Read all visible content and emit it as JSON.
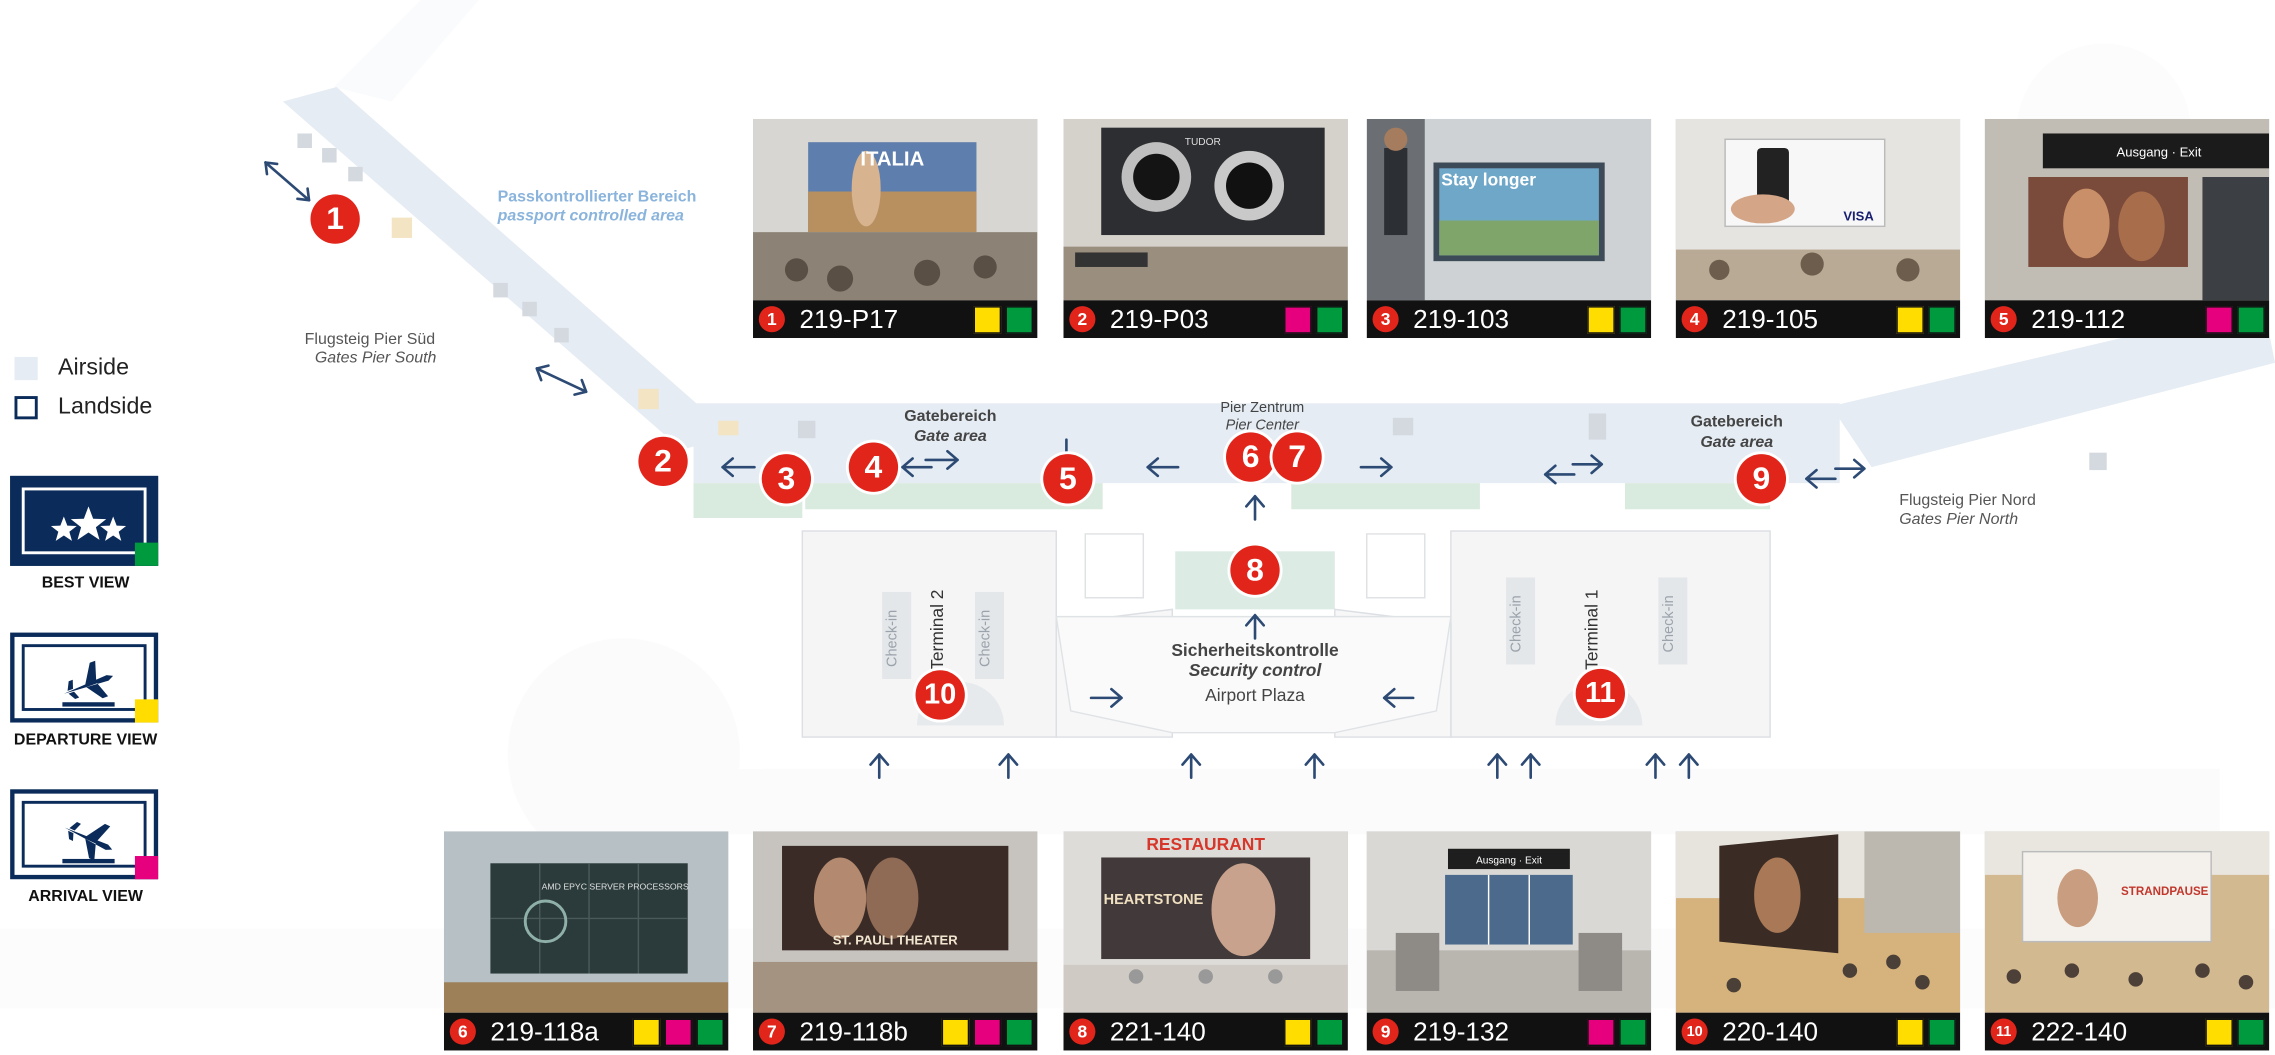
{
  "legend": {
    "airside_label": "Airside",
    "landside_label": "Landside",
    "airside_color": "#e5ecf3",
    "landside_color": "#ffffff"
  },
  "view_types": [
    {
      "label": "BEST VIEW",
      "icon": "stars-icon",
      "color": "#009a3e"
    },
    {
      "label": "DEPARTURE VIEW",
      "icon": "plane-departure-icon",
      "color": "#ffdd00"
    },
    {
      "label": "ARRIVAL VIEW",
      "icon": "plane-arrival-icon",
      "color": "#e6007e"
    }
  ],
  "map_labels": {
    "passport_de": "Passkontrollierter Bereich",
    "passport_en": "passport controlled area",
    "pier_south_de": "Flugsteig Pier Süd",
    "pier_south_en": "Gates Pier South",
    "pier_north_de": "Flugsteig Pier Nord",
    "pier_north_en": "Gates Pier North",
    "gate_area_left_de": "Gatebereich",
    "gate_area_left_en": "Gate area",
    "gate_area_right_de": "Gatebereich",
    "gate_area_right_en": "Gate area",
    "pier_center_de": "Pier Zentrum",
    "pier_center_en": "Pier Center",
    "security_de": "Sicherheitskontrolle",
    "security_en": "Security control",
    "airport_plaza": "Airport Plaza",
    "terminal2": "Terminal 2",
    "terminal1": "Terminal 1",
    "checkin": "Check-in"
  },
  "locations": [
    {
      "num": "1",
      "code": "219-P17",
      "views": [
        "yellow",
        "green"
      ]
    },
    {
      "num": "2",
      "code": "219-P03",
      "views": [
        "magenta",
        "green"
      ]
    },
    {
      "num": "3",
      "code": "219-103",
      "views": [
        "yellow",
        "green"
      ]
    },
    {
      "num": "4",
      "code": "219-105",
      "views": [
        "yellow",
        "green"
      ]
    },
    {
      "num": "5",
      "code": "219-112",
      "views": [
        "magenta",
        "green"
      ]
    },
    {
      "num": "6",
      "code": "219-118a",
      "views": [
        "yellow",
        "magenta",
        "green"
      ]
    },
    {
      "num": "7",
      "code": "219-118b",
      "views": [
        "yellow",
        "magenta",
        "green"
      ]
    },
    {
      "num": "8",
      "code": "221-140",
      "views": [
        "yellow",
        "green"
      ]
    },
    {
      "num": "9",
      "code": "219-132",
      "views": [
        "magenta",
        "green"
      ]
    },
    {
      "num": "10",
      "code": "220-140",
      "views": [
        "yellow",
        "green"
      ]
    },
    {
      "num": "11",
      "code": "222-140",
      "views": [
        "yellow",
        "green"
      ]
    }
  ],
  "photo_texts": {
    "p1": "ITALIA",
    "p2": "TUDOR",
    "p3": "Stay longer",
    "p4": "VISA",
    "p5": "Ausgang · Exit",
    "p6": "AMD EPYC SERVER PROCESSORS",
    "p7": "ST. PAULI THEATER",
    "p8_top": "RESTAURANT",
    "p8_main": "HEARTSTONE",
    "p9": "Ausgang · Exit",
    "p11": "STRANDPAUSE"
  },
  "colors": {
    "pin": "#e1251b",
    "navy": "#0b2c5a",
    "yellow": "#ffdd00",
    "magenta": "#e6007e",
    "green": "#009a3e",
    "passport_text": "#8ab4dc"
  }
}
